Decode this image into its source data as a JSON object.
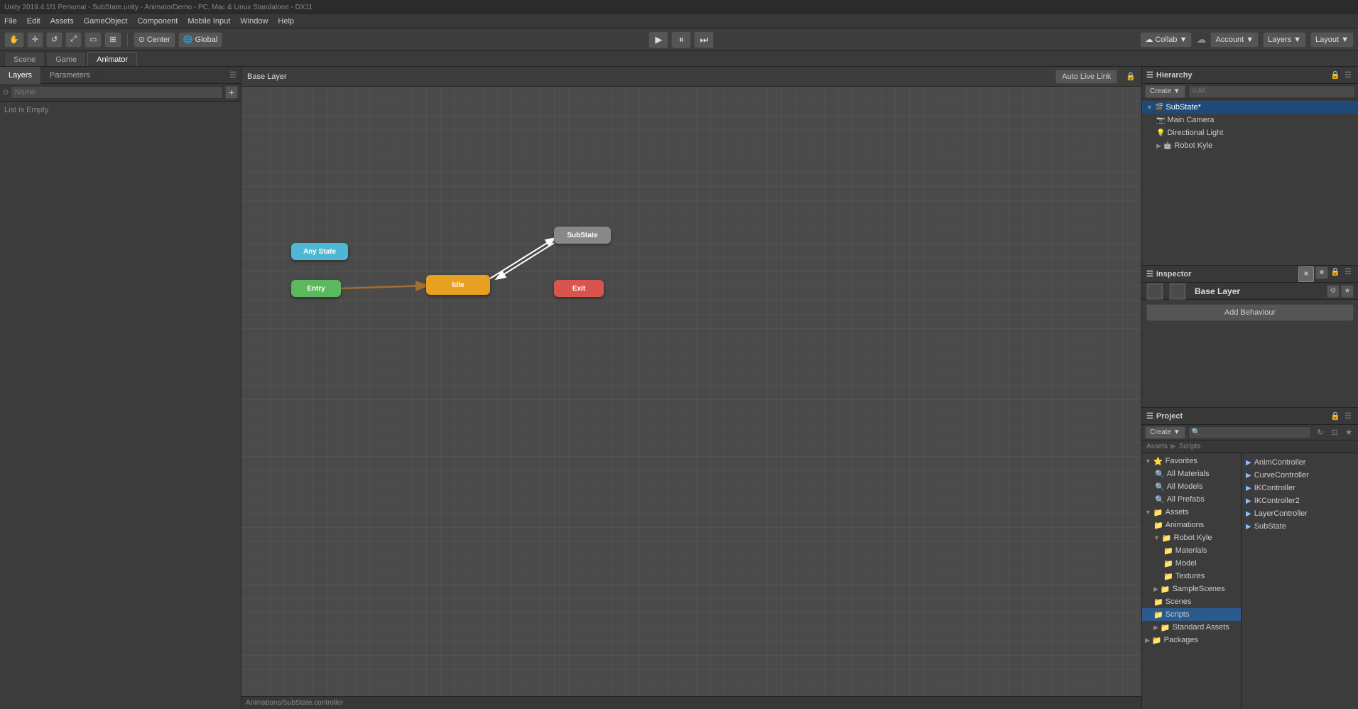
{
  "window": {
    "title": "Unity 2019.4.1f1 Personal - SubState.unity - AnimatorDemo - PC, Mac & Linux Standalone - DX11"
  },
  "menu": {
    "items": [
      "File",
      "Edit",
      "Assets",
      "GameObject",
      "Component",
      "Mobile Input",
      "Window",
      "Help"
    ]
  },
  "toolbar": {
    "tools": [
      "hand",
      "move",
      "rotate",
      "scale",
      "rect",
      "transform"
    ],
    "center_btn": "Center",
    "global_btn": "Global",
    "play": "▶",
    "pause": "⏸",
    "step": "⏭",
    "collab": "Collab ▼",
    "account": "Account",
    "layers": "Layers",
    "layout": "Layout ▼"
  },
  "tabs": {
    "scene": "Scene",
    "game": "Game",
    "animator": "Animator"
  },
  "animator": {
    "panels": {
      "layers_tab": "Layers",
      "params_tab": "Parameters",
      "search_placeholder": "Name",
      "list_empty": "List is Empty"
    },
    "graph": {
      "breadcrumb": "Base Layer",
      "auto_live_btn": "Auto Live Link",
      "nodes": {
        "any_state": "Any State",
        "entry": "Entry",
        "idle": "Idle",
        "substate": "SubState",
        "exit": "Exit"
      },
      "status": "Animations/SubState.controller"
    }
  },
  "hierarchy": {
    "title": "Hierarchy",
    "create_btn": "Create ▼",
    "search_placeholder": "⊙All",
    "items": [
      {
        "label": "SubState*",
        "level": 0,
        "type": "scene",
        "expanded": true,
        "selected": true
      },
      {
        "label": "Main Camera",
        "level": 1,
        "type": "camera"
      },
      {
        "label": "Directional Light",
        "level": 1,
        "type": "light"
      },
      {
        "label": "Robot Kyle",
        "level": 1,
        "type": "robot",
        "expanded": false
      }
    ]
  },
  "inspector": {
    "title": "Inspector",
    "layer_name": "Base Layer",
    "add_behaviour_btn": "Add Behaviour"
  },
  "project": {
    "title": "Project",
    "create_btn": "Create ▼",
    "path": {
      "assets": "Assets",
      "scripts": "Scripts"
    },
    "tree": {
      "favorites": {
        "label": "Favorites",
        "children": [
          "All Materials",
          "All Models",
          "All Prefabs"
        ]
      },
      "assets": {
        "label": "Assets",
        "children": [
          {
            "label": "Animations",
            "type": "folder"
          },
          {
            "label": "Robot Kyle",
            "type": "folder",
            "expanded": true,
            "children": [
              "Materials",
              "Model",
              "Textures"
            ]
          },
          {
            "label": "SampleScenes",
            "type": "folder"
          },
          {
            "label": "Scenes",
            "type": "folder"
          },
          {
            "label": "Scripts",
            "type": "folder",
            "selected": true
          },
          {
            "label": "Standard Assets",
            "type": "folder"
          }
        ]
      },
      "packages": "Packages"
    },
    "files": [
      "AnimController",
      "CurveController",
      "IKController",
      "IKController2",
      "LayerController",
      "SubState"
    ]
  }
}
